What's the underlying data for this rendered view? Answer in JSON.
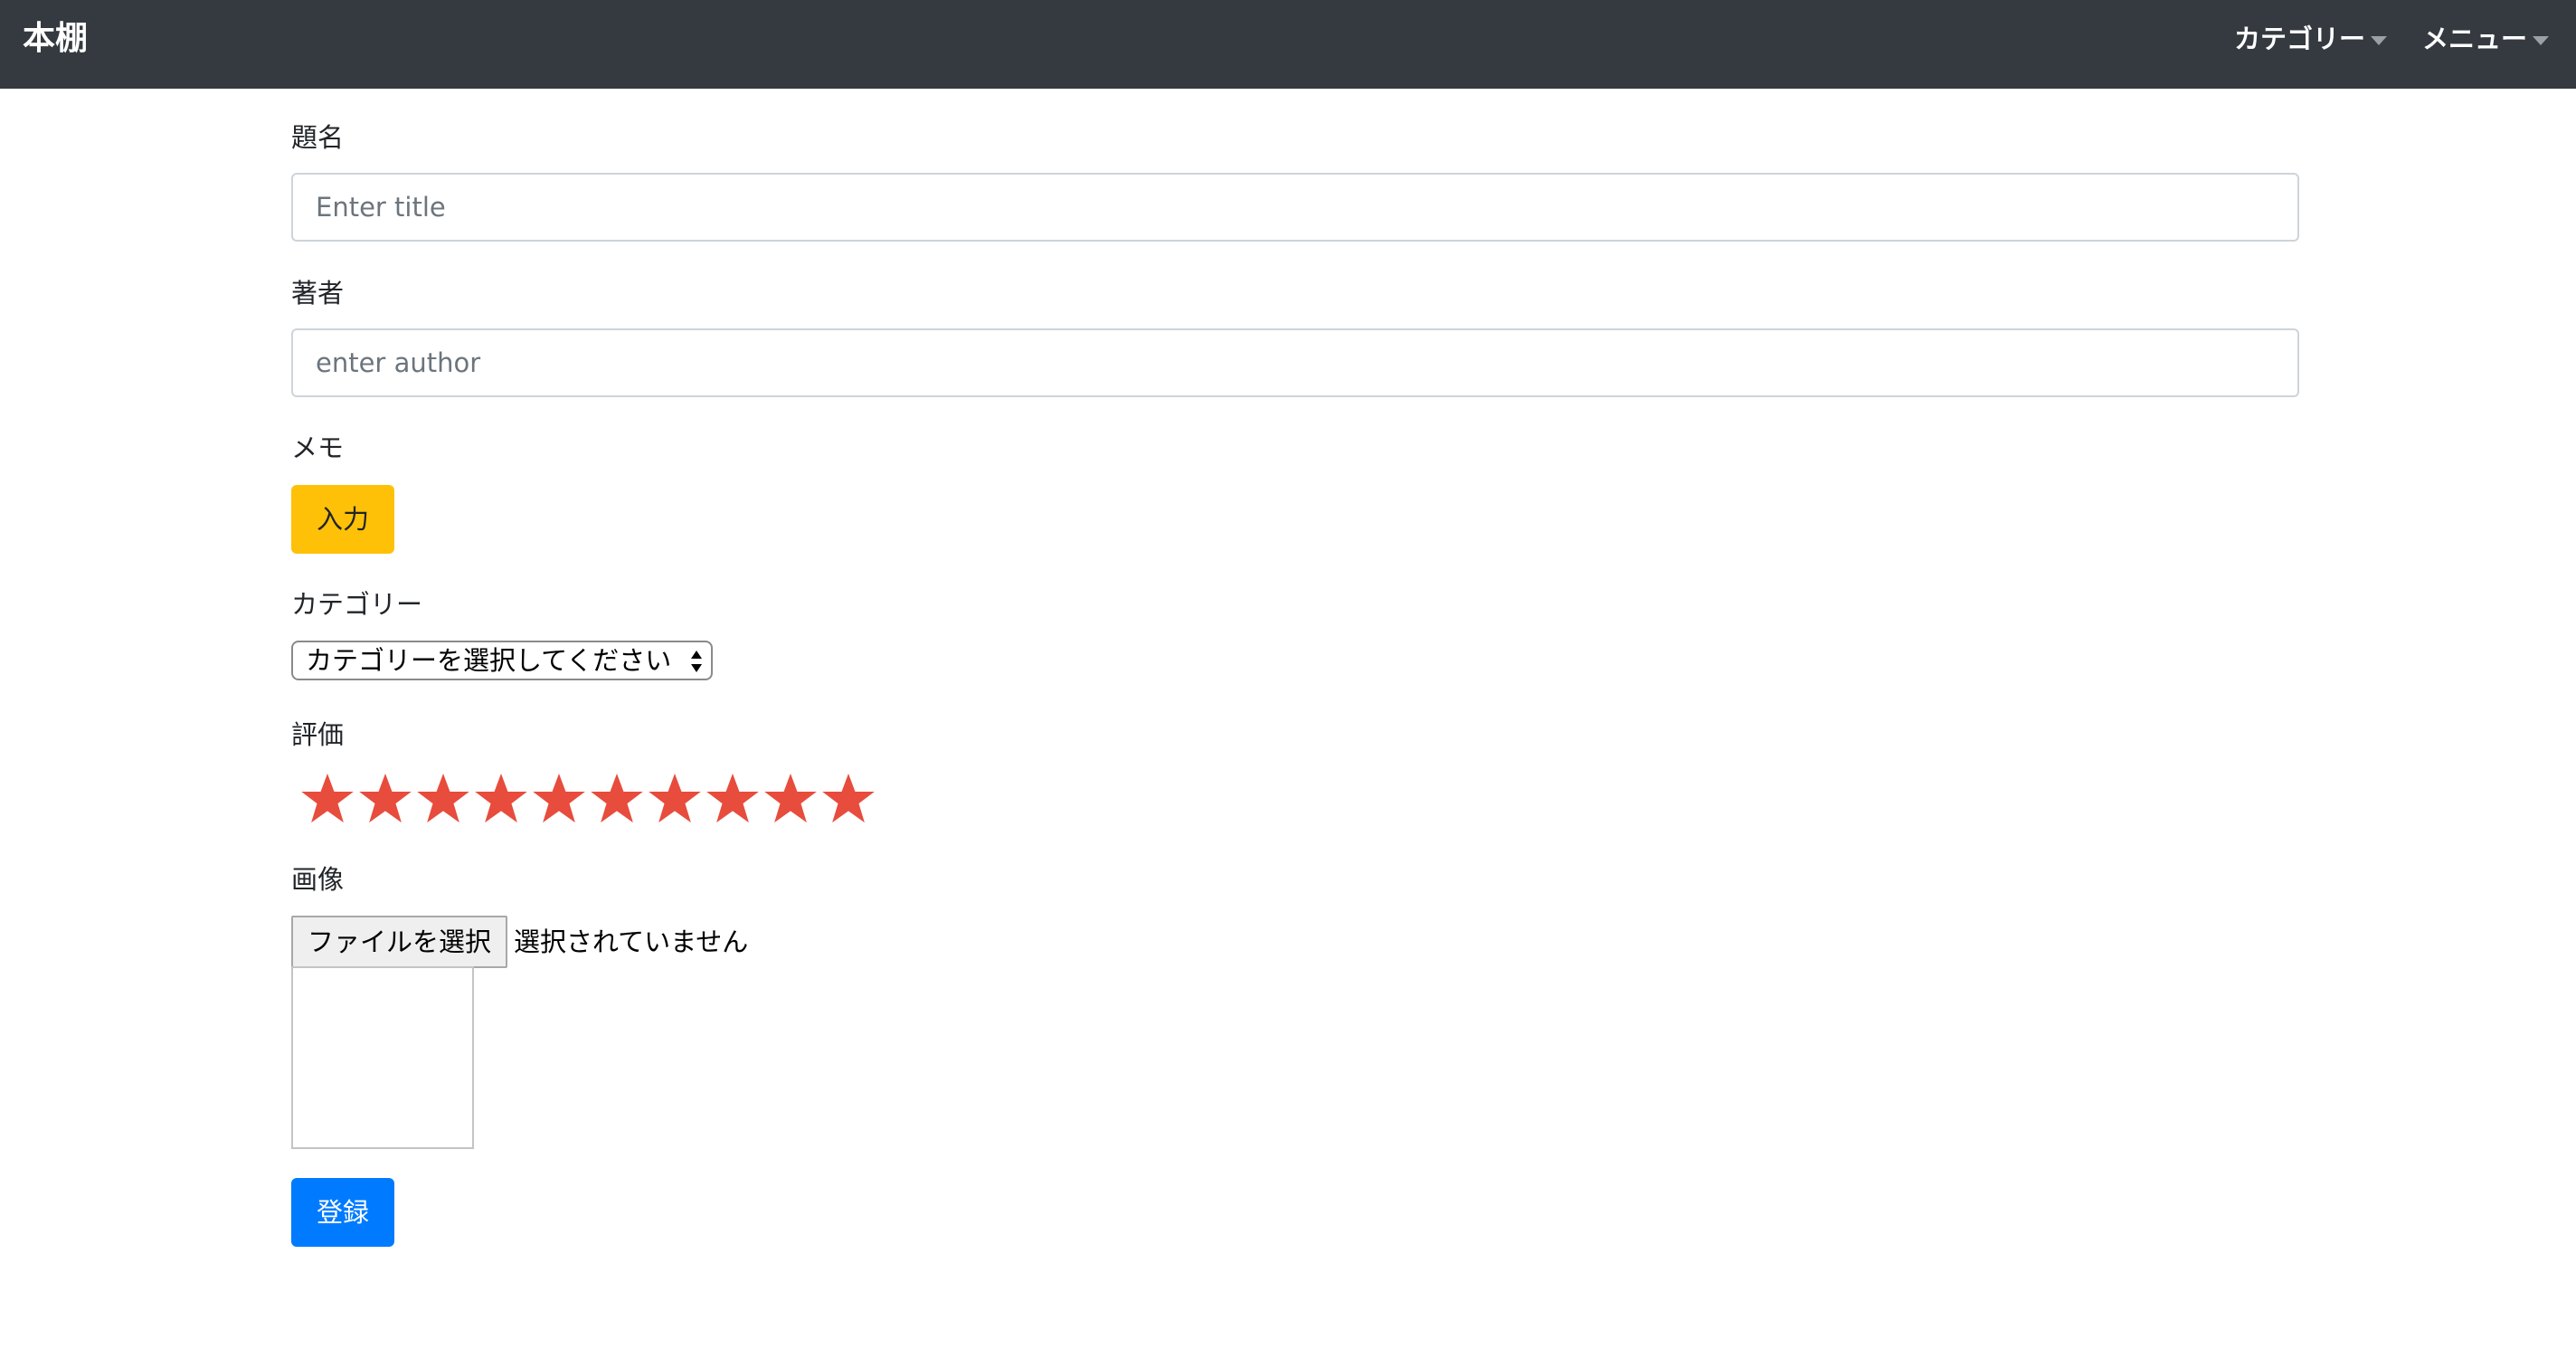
{
  "navbar": {
    "brand": "本棚",
    "category_menu": "カテゴリー",
    "main_menu": "メニュー"
  },
  "form": {
    "title_label": "題名",
    "title_placeholder": "Enter title",
    "title_value": "",
    "author_label": "著者",
    "author_placeholder": "enter author",
    "author_value": "",
    "memo_label": "メモ",
    "memo_button": "入力",
    "category_label": "カテゴリー",
    "category_selected": "カテゴリーを選択してください",
    "rating_label": "評価",
    "rating": {
      "value": 10,
      "max": 10,
      "color": "#e74c3c"
    },
    "image_label": "画像",
    "file_button": "ファイルを選択",
    "file_status": "選択されていません",
    "submit_button": "登録"
  },
  "colors": {
    "navbar_bg": "#343a40",
    "warning": "#ffc107",
    "primary": "#007bff",
    "star": "#e74c3c"
  }
}
